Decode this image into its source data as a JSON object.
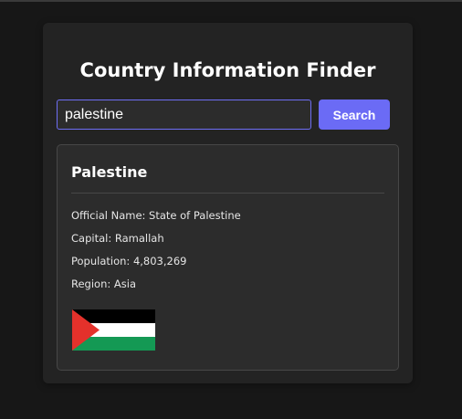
{
  "app": {
    "title": "Country Information Finder"
  },
  "search": {
    "value": "palestine",
    "button_label": "Search"
  },
  "result": {
    "country_name": "Palestine",
    "official_name_label": "Official Name:",
    "official_name": "State of Palestine",
    "capital_label": "Capital:",
    "capital": "Ramallah",
    "population_label": "Population:",
    "population": "4,803,269",
    "region_label": "Region:",
    "region": "Asia",
    "flag_icon": "palestine-flag-icon"
  },
  "colors": {
    "page_background": "#171717",
    "card_background": "#232323",
    "result_background": "#2c2c2c",
    "accent": "#6b6bf5",
    "flag_black": "#000000",
    "flag_white": "#ffffff",
    "flag_green": "#149954",
    "flag_red": "#e4312b"
  }
}
